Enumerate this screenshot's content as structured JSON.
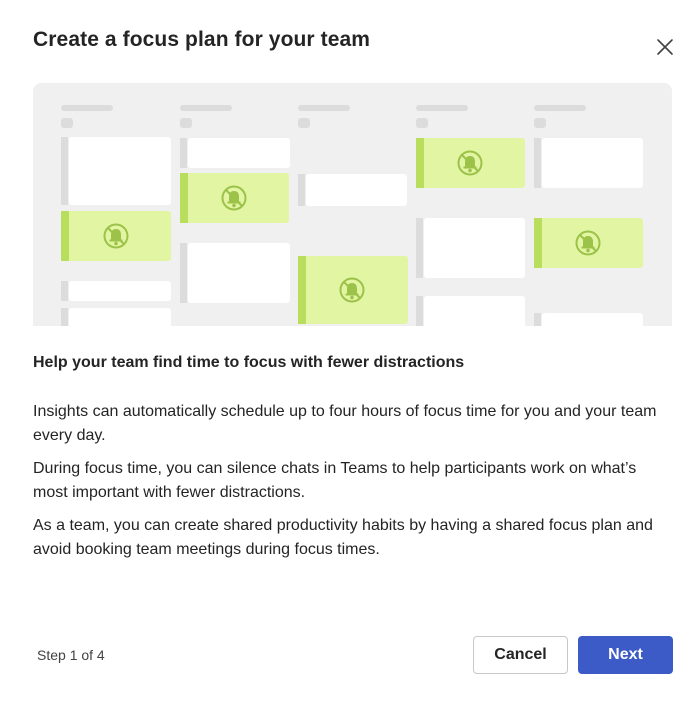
{
  "dialog": {
    "title": "Create a focus plan for your team",
    "close_icon": "close-icon",
    "illustration": {
      "description_icon": "muted-bell-icon",
      "focus_color": "#e2f5a3",
      "focus_stripe_color": "#b9de5e",
      "background_color": "#f0f0f0"
    },
    "subtitle": "Help your team find time to focus with fewer distractions",
    "paragraphs": [
      "Insights can automatically schedule up to four hours of focus time for you and your team every day.",
      "During focus time, you can silence chats in Teams to help participants work on what’s most important with fewer distractions.",
      "As a team, you can create shared productivity habits by having a shared focus plan and avoid booking team meetings during focus times."
    ],
    "footer": {
      "step_text": "Step 1 of 4",
      "cancel_label": "Cancel",
      "next_label": "Next"
    },
    "colors": {
      "primary": "#3d5bc7"
    }
  }
}
